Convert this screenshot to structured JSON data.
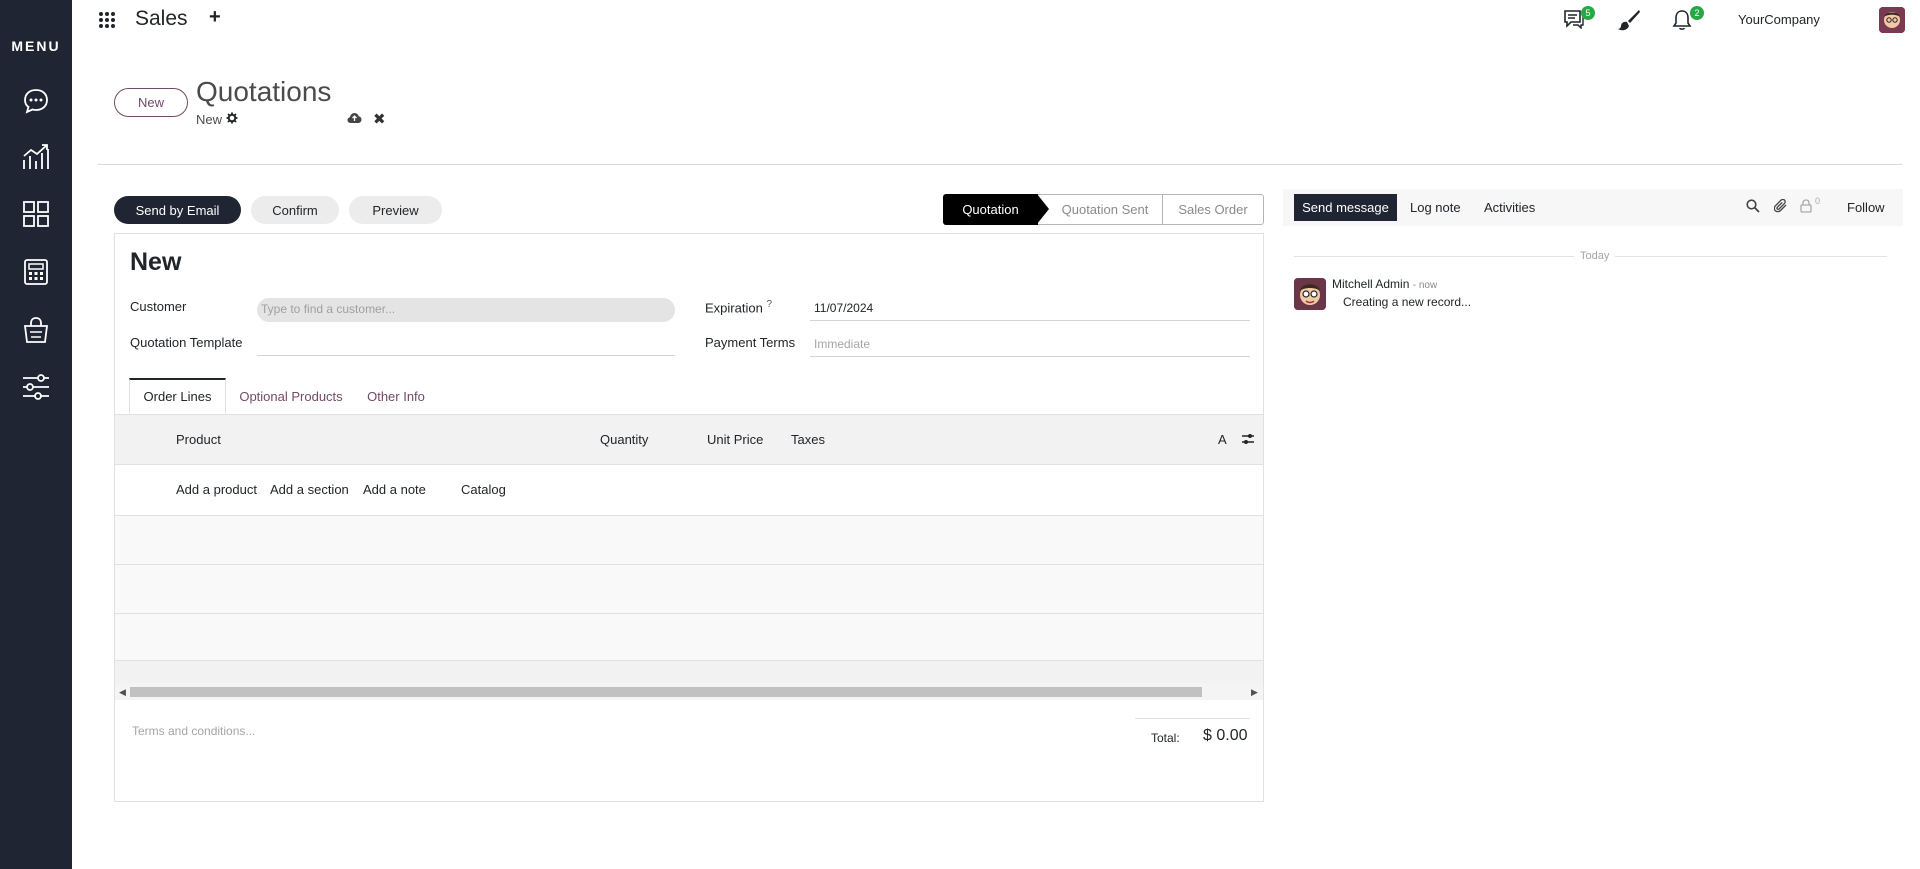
{
  "sidebar": {
    "menu_label": "MENU",
    "items": [
      {
        "icon": "chat-bubble-icon"
      },
      {
        "icon": "trend-chart-icon"
      },
      {
        "icon": "grid-apps-icon"
      },
      {
        "icon": "calculator-icon"
      },
      {
        "icon": "shopping-basket-icon"
      },
      {
        "icon": "sliders-settings-icon"
      }
    ]
  },
  "topbar": {
    "app_title": "Sales",
    "plus": "+",
    "messages_count": "5",
    "activities_count": "2",
    "company": "YourCompany"
  },
  "control_panel": {
    "new_button": "New",
    "title": "Quotations",
    "record_breadcrumb": "New",
    "discard_symbol": "✖"
  },
  "actions": {
    "send_by_email": "Send by Email",
    "confirm": "Confirm",
    "preview": "Preview"
  },
  "statusbar": {
    "stages": [
      "Quotation",
      "Quotation Sent",
      "Sales Order"
    ],
    "active_index": 0
  },
  "form": {
    "record_name": "New",
    "customer_label": "Customer",
    "customer_placeholder": "Type to find a customer...",
    "template_label": "Quotation Template",
    "template_value": "",
    "expiration_label": "Expiration",
    "expiration_help": "?",
    "expiration_value": "11/07/2024",
    "payment_terms_label": "Payment Terms",
    "payment_terms_placeholder": "Immediate"
  },
  "tabs": [
    {
      "label": "Order Lines",
      "active": true
    },
    {
      "label": "Optional Products",
      "active": false
    },
    {
      "label": "Other Info",
      "active": false
    }
  ],
  "order_table": {
    "columns": [
      "Product",
      "Quantity",
      "Unit Price",
      "Taxes",
      "A"
    ],
    "add_links": [
      "Add a product",
      "Add a section",
      "Add a note",
      "Catalog"
    ]
  },
  "footer": {
    "terms_placeholder": "Terms and conditions...",
    "total_label": "Total:",
    "total_value": "$ 0.00"
  },
  "chatter": {
    "send_message": "Send message",
    "log_note": "Log note",
    "activities": "Activities",
    "followers_count": "0",
    "follow": "Follow",
    "date_separator": "Today",
    "message": {
      "author": "Mitchell Admin",
      "time": "- now",
      "body": "Creating a new record..."
    }
  },
  "colors": {
    "sidebar_bg": "#1f2533",
    "accent": "#714b67",
    "badge": "#28a745"
  }
}
